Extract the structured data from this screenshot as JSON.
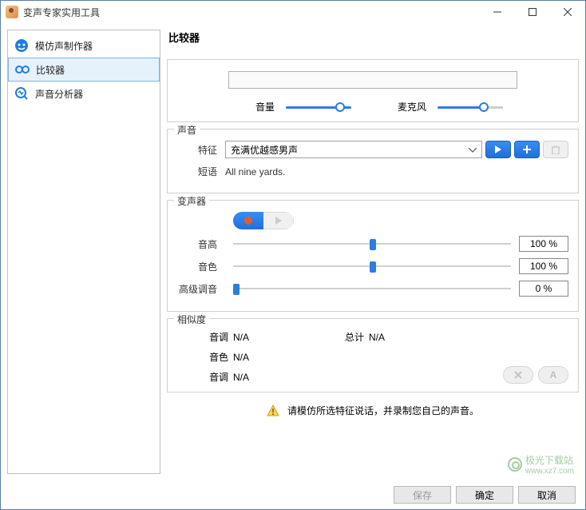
{
  "titlebar": {
    "title": "变声专家实用工具"
  },
  "sidebar": {
    "items": [
      {
        "label": "模仿声制作器"
      },
      {
        "label": "比较器"
      },
      {
        "label": "声音分析器"
      }
    ]
  },
  "main": {
    "heading": "比较器",
    "vol_label": "音量",
    "mic_label": "麦克风",
    "sound_section": "声音",
    "feature_label": "特征",
    "feature_value": "充满优越感男声",
    "phrase_label": "短语",
    "phrase_value": "All nine yards.",
    "changer_section": "变声器",
    "pitch_label": "音高",
    "pitch_value": "100 %",
    "timbre_label": "音色",
    "timbre_value": "100 %",
    "advtune_label": "高级调音",
    "advtune_value": "0 %",
    "sim_section": "相似度",
    "sim_pitch_label": "音调",
    "sim_pitch_value": "N/A",
    "sim_total_label": "总计",
    "sim_total_value": "N/A",
    "sim_timbre_label": "音色",
    "sim_timbre_value": "N/A",
    "sim_tone_label": "音调",
    "sim_tone_value": "N/A",
    "hint": "请模仿所选特征说话，并录制您自己的声音。"
  },
  "footer": {
    "save": "保存",
    "ok": "确定",
    "cancel": "取消"
  },
  "watermark": {
    "text": "极光下载站",
    "url": "www.xz7.com"
  }
}
